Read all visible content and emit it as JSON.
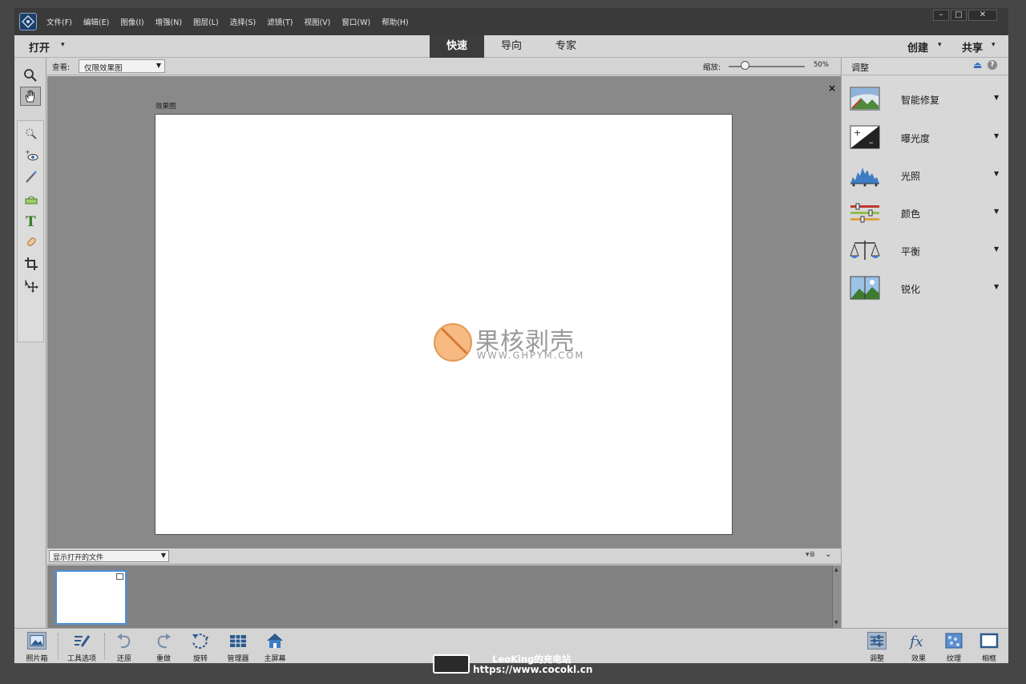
{
  "menubar": {
    "items": [
      "文件(F)",
      "编辑(E)",
      "图像(I)",
      "增强(N)",
      "图层(L)",
      "选择(S)",
      "滤镜(T)",
      "视图(V)",
      "窗口(W)",
      "帮助(H)"
    ],
    "window_controls": {
      "minimize": "–",
      "maximize": "□",
      "close": "✕"
    }
  },
  "modebar": {
    "open_label": "打开",
    "caret": "▾",
    "tabs": [
      {
        "label": "快速",
        "active": true
      },
      {
        "label": "导向",
        "active": false
      },
      {
        "label": "专家",
        "active": false
      }
    ],
    "create_label": "创建",
    "share_label": "共享"
  },
  "options": {
    "view_label": "查看:",
    "view_value": "仅限效果图",
    "zoom_label": "缩放:",
    "zoom_value": "50%",
    "zoom_percent": 50
  },
  "canvas": {
    "close_glyph": "×",
    "doc_label": "效果图",
    "watermark_title": "果核剥壳",
    "watermark_url": "WWW.GHPYM.COM"
  },
  "bin": {
    "select_value": "显示打开的文件",
    "menu_glyph": "▾≣",
    "collapse_glyph": "⌄"
  },
  "panel": {
    "title": "调整",
    "help": "?",
    "items": [
      {
        "label": "智能修复",
        "icon": "smart-fix-icon"
      },
      {
        "label": "曝光度",
        "icon": "exposure-icon"
      },
      {
        "label": "光照",
        "icon": "lighting-icon"
      },
      {
        "label": "颜色",
        "icon": "color-icon"
      },
      {
        "label": "平衡",
        "icon": "balance-icon"
      },
      {
        "label": "锐化",
        "icon": "sharpen-icon"
      }
    ]
  },
  "bottombar": {
    "left": [
      {
        "label": "照片箱",
        "icon": "photo-bin-icon"
      },
      {
        "label": "工具选项",
        "icon": "tool-options-icon"
      },
      {
        "label": "还原",
        "icon": "undo-icon"
      },
      {
        "label": "重做",
        "icon": "redo-icon"
      },
      {
        "label": "旋转",
        "icon": "rotate-icon"
      },
      {
        "label": "管理器",
        "icon": "organizer-icon"
      },
      {
        "label": "主屏幕",
        "icon": "home-screen-icon"
      }
    ],
    "right": [
      {
        "label": "调整",
        "icon": "adjustments-icon"
      },
      {
        "label": "效果",
        "icon": "effects-icon"
      },
      {
        "label": "纹理",
        "icon": "textures-icon"
      },
      {
        "label": "相框",
        "icon": "frames-icon"
      }
    ]
  },
  "overlay": {
    "line1": "LeoKing的充电站",
    "line2": "https://www.cocokl.cn"
  }
}
